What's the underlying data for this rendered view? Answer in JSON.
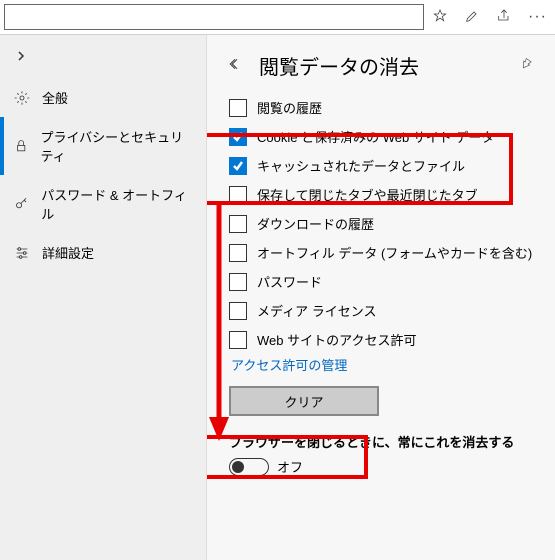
{
  "sidebar": {
    "items": [
      {
        "label": "全般"
      },
      {
        "label": "プライバシーとセキュリティ"
      },
      {
        "label": "パスワード & オートフィル"
      },
      {
        "label": "詳細設定"
      }
    ]
  },
  "panel": {
    "title": "閲覧データの消去",
    "checkboxes": [
      {
        "label": "閲覧の履歴",
        "checked": false
      },
      {
        "label": "Cookie と保存済みの Web サイト データ",
        "checked": true
      },
      {
        "label": "キャッシュされたデータとファイル",
        "checked": true
      },
      {
        "label": "保存して閉じたタブや最近閉じたタブ",
        "checked": false
      },
      {
        "label": "ダウンロードの履歴",
        "checked": false
      },
      {
        "label": "オートフィル データ (フォームやカードを含む)",
        "checked": false
      },
      {
        "label": "パスワード",
        "checked": false
      },
      {
        "label": "メディア ライセンス",
        "checked": false
      },
      {
        "label": "Web サイトのアクセス許可",
        "checked": false
      }
    ],
    "manage_link": "アクセス許可の管理",
    "clear_button": "クリア",
    "always_clear_label": "ブラウザーを閉じるときに、常にこれを消去する",
    "toggle_off": "オフ"
  }
}
